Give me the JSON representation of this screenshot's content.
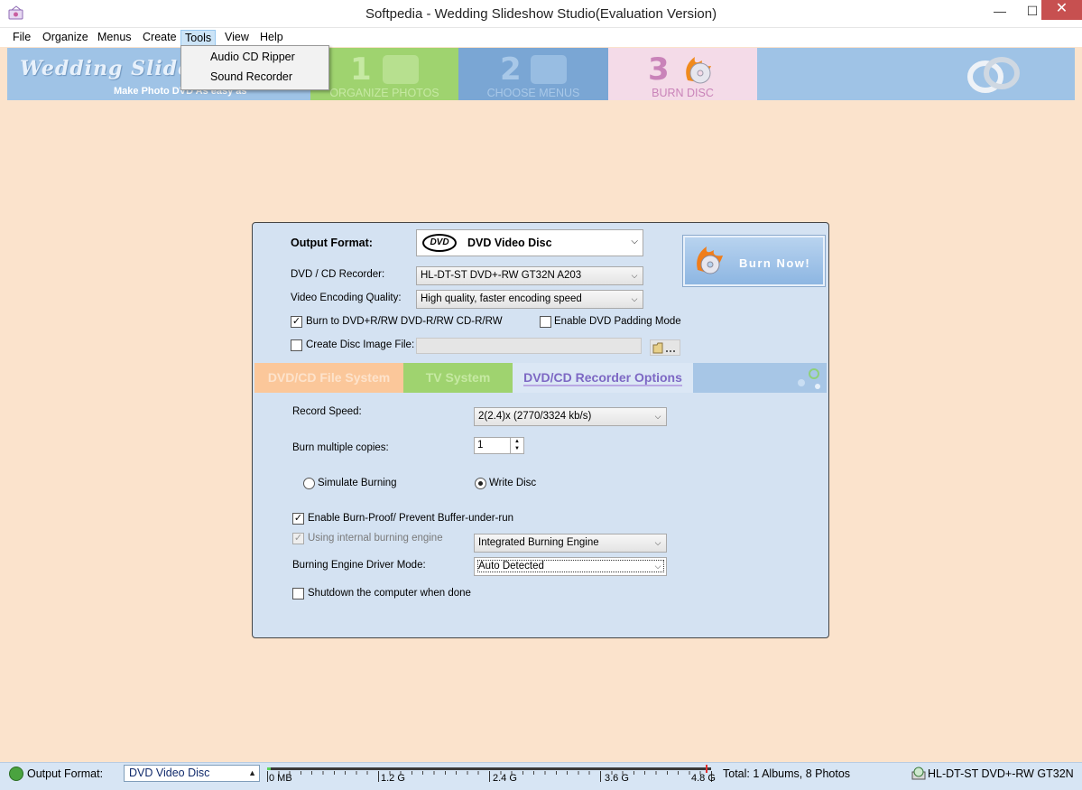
{
  "window": {
    "title": "Softpedia - Wedding Slideshow Studio(Evaluation Version)",
    "minimize": "—",
    "maximize": "☐",
    "close": "✕"
  },
  "menu": {
    "file": "File",
    "organize": "Organize",
    "menus": "Menus",
    "create": "Create",
    "tools": "Tools",
    "view": "View",
    "help": "Help"
  },
  "tools_menu": {
    "audio_cd_ripper": "Audio CD Ripper",
    "sound_recorder": "Sound Recorder"
  },
  "banner": {
    "logo": "Wedding Slides",
    "tagline": "Make Photo DVD As easy as",
    "steps": [
      {
        "number": "1",
        "label": "ORGANIZE PHOTOS"
      },
      {
        "number": "2",
        "label": "CHOOSE MENUS"
      },
      {
        "number": "3",
        "label": "BURN  DISC"
      }
    ]
  },
  "panel": {
    "output_format_label": "Output Format:",
    "output_format_logo": "DVD",
    "output_format_value": "DVD Video Disc",
    "recorder_label": "DVD / CD Recorder:",
    "recorder_value": "HL-DT-ST DVD+-RW GT32N    A203",
    "quality_label": "Video Encoding Quality:",
    "quality_value": "High quality, faster encoding speed",
    "burn_to_label": "Burn to DVD+R/RW DVD-R/RW  CD-R/RW",
    "burn_to_checked": true,
    "padding_label": "Enable DVD Padding Mode",
    "padding_checked": false,
    "disc_image_label": "Create Disc Image File:",
    "disc_image_checked": false,
    "disc_image_path": "",
    "burn_now": "Burn Now!"
  },
  "tabs": {
    "file_system": "DVD/CD File System",
    "tv_system": "TV System",
    "recorder_options": "DVD/CD Recorder Options"
  },
  "recorder_options": {
    "record_speed_label": "Record Speed:",
    "record_speed_value": "2(2.4)x (2770/3324 kb/s)",
    "copies_label": "Burn multiple copies:",
    "copies_value": "1",
    "simulate_label": "Simulate Burning",
    "write_label": "Write Disc",
    "selected_mode": "Write Disc",
    "burn_proof_label": "Enable Burn-Proof/ Prevent Buffer-under-run",
    "burn_proof_checked": true,
    "internal_engine_label": "Using internal burning engine",
    "internal_engine_checked": true,
    "engine_value": "Integrated Burning Engine",
    "driver_mode_label": "Burning Engine Driver Mode:",
    "driver_mode_value": "Auto Detected",
    "shutdown_label": "Shutdown the computer when done",
    "shutdown_checked": false
  },
  "statusbar": {
    "output_format_label": "Output Format:",
    "output_format_value": "DVD Video Disc",
    "meter_ticks": [
      "0 MB",
      "1.2 G",
      "2.4 G",
      "3.6 G",
      "4.8 G"
    ],
    "meter_used_fraction": 0.008,
    "total": "Total: 1 Albums, 8 Photos",
    "drive": "HL-DT-ST DVD+-RW GT32N"
  },
  "colors": {
    "background": "#fbe3cc",
    "panel": "#d4e2f2",
    "banner": "#9fc3e6",
    "step1": "#9fd36f",
    "step2": "#7aa6d4",
    "step3": "#f4dbe8",
    "close_button": "#c75050",
    "tab_active_text": "#7d68c4"
  },
  "icons": {
    "app": "wedding-app-icon",
    "burn": "flaming-disc-icon",
    "folder": "folder-browse-icon",
    "status_globe": "globe-icon",
    "drive": "disc-drive-icon",
    "rings": "wedding-rings-icon"
  }
}
